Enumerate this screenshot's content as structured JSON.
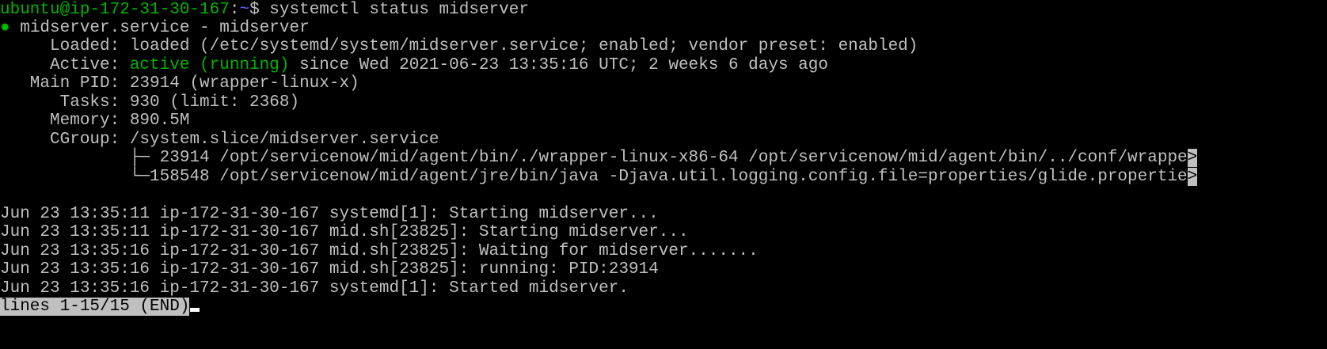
{
  "prompt": {
    "user_host": "ubuntu@ip-172-31-30-167",
    "colon": ":",
    "cwd": "~",
    "symbol": "$ ",
    "command": "systemctl status midserver"
  },
  "service": {
    "bullet": "●",
    "header": " midserver.service - midserver",
    "loaded_label": "     Loaded: ",
    "loaded_value": "loaded (/etc/systemd/system/midserver.service; enabled; vendor preset: enabled)",
    "active_label": "     Active: ",
    "active_state": "active (running)",
    "active_since": " since Wed 2021-06-23 13:35:16 UTC; 2 weeks 6 days ago",
    "pid_label": "   Main PID: ",
    "pid_value": "23914 (wrapper-linux-x)",
    "tasks_label": "      Tasks: ",
    "tasks_value": "930 (limit: 2368)",
    "memory_label": "     Memory: ",
    "memory_value": "890.5M",
    "cgroup_label": "     CGroup: ",
    "cgroup_value": "/system.slice/midserver.service",
    "cgroup_children": [
      {
        "tree": "             ├─ ",
        "text": "23914 /opt/servicenow/mid/agent/bin/./wrapper-linux-x86-64 /opt/servicenow/mid/agent/bin/../conf/wrappe",
        "more": ">"
      },
      {
        "tree": "             └─",
        "text": "158548 /opt/servicenow/mid/agent/jre/bin/java -Djava.util.logging.config.file=properties/glide.propertie",
        "more": ">"
      }
    ]
  },
  "log_lines": [
    "Jun 23 13:35:11 ip-172-31-30-167 systemd[1]: Starting midserver...",
    "Jun 23 13:35:11 ip-172-31-30-167 mid.sh[23825]: Starting midserver...",
    "Jun 23 13:35:16 ip-172-31-30-167 mid.sh[23825]: Waiting for midserver.......",
    "Jun 23 13:35:16 ip-172-31-30-167 mid.sh[23825]: running: PID:23914",
    "Jun 23 13:35:16 ip-172-31-30-167 systemd[1]: Started midserver."
  ],
  "pager": {
    "status": "lines 1-15/15 (END)"
  },
  "colors": {
    "background": "#000000",
    "text": "#c0c0c0",
    "green": "#00b300",
    "blue": "#5c5cff"
  }
}
